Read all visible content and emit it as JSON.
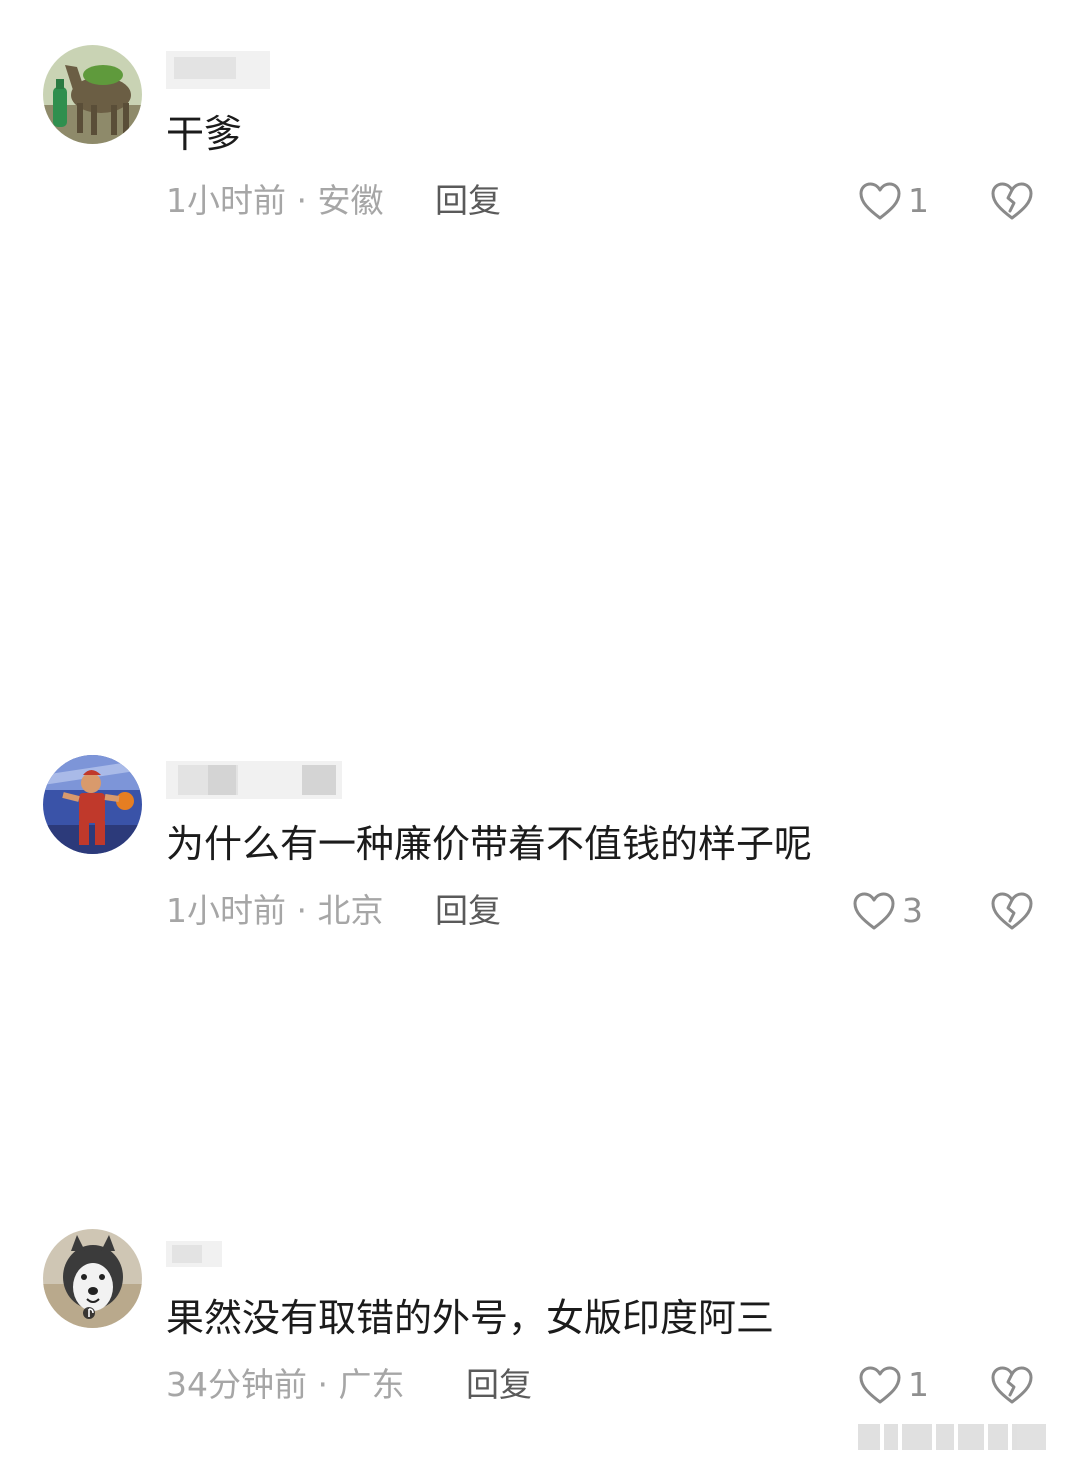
{
  "comments": [
    {
      "text": "干爹",
      "time": "1小时前",
      "location": "安徽",
      "reply_label": "回复",
      "likes": "1"
    },
    {
      "text": "为什么有一种廉价带着不值钱的样子呢",
      "time": "1小时前",
      "location": "北京",
      "reply_label": "回复",
      "likes": "3"
    },
    {
      "text": "果然没有取错的外号，女版印度阿三",
      "time": "34分钟前",
      "location": "广东",
      "reply_label": "回复",
      "likes": "1"
    }
  ],
  "meta_separator": " · ",
  "icons": {
    "like": "heart-outline-icon",
    "dislike": "broken-heart-icon"
  },
  "colors": {
    "text": "#1b1b1b",
    "meta": "#a6a6a6",
    "reply": "#5a5a5a",
    "icon": "#8a8a8a"
  }
}
